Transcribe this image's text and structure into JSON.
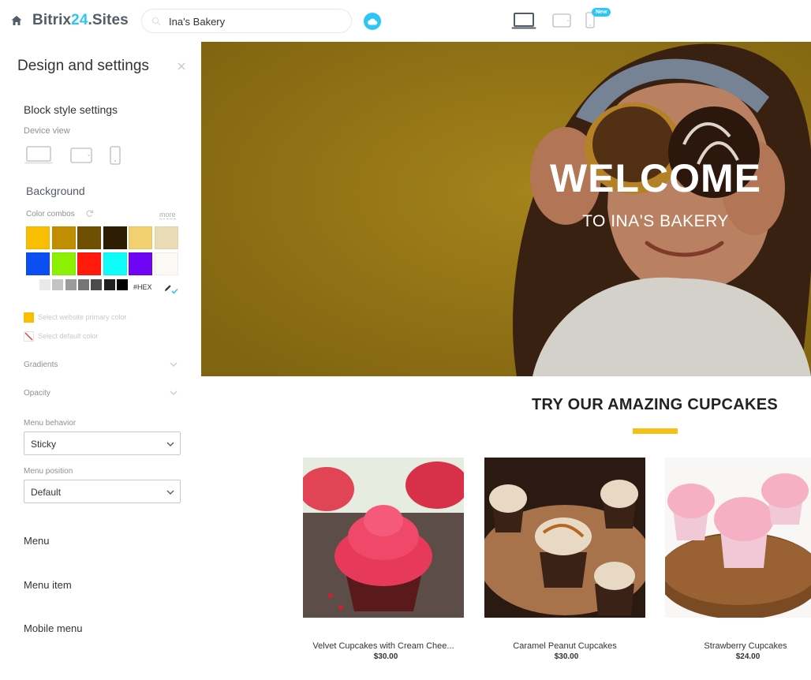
{
  "app": {
    "logo_part1": "Bitrix",
    "logo_part2": "24",
    "logo_part3": ".Sites",
    "site_name": "Ina's Bakery",
    "new_badge": "New"
  },
  "panel": {
    "title": "Design and settings",
    "section_title": "Block style settings",
    "device_view_label": "Device view",
    "background_title": "Background",
    "color_combos_label": "Color combos",
    "more_link": "more",
    "colors_row1": [
      "#f9bd02",
      "#c08d03",
      "#6f4f02",
      "#2d1d05",
      "#f2d06f",
      "#eadbb7"
    ],
    "colors_row2": [
      "#0b4ff2",
      "#8cf003",
      "#ff1a0b",
      "#0dfcfa",
      "#7005f5",
      "#fbf9f3"
    ],
    "grays": [
      "#e9e9e9",
      "#c3c3c3",
      "#9b9b9b",
      "#757575",
      "#4b4b4b",
      "#1f1f1f",
      "#000000"
    ],
    "hex_label": "#HEX",
    "primary_color_text": "Select website primary color",
    "default_color_text": "Select default color",
    "primary_color_value": "#f9bd02",
    "gradients_label": "Gradients",
    "opacity_label": "Opacity",
    "menu_behavior_label": "Menu behavior",
    "menu_behavior_value": "Sticky",
    "menu_position_label": "Menu position",
    "menu_position_value": "Default",
    "links": [
      "Menu",
      "Menu item",
      "Mobile menu"
    ]
  },
  "hero": {
    "title": "WELCOME",
    "subtitle": "TO INA'S BAKERY"
  },
  "products_section": {
    "heading": "TRY OUR AMAZING CUPCAKES",
    "accent_color": "#f5c116",
    "items": [
      {
        "name": "Velvet Cupcakes with Cream Chee...",
        "price": "$30.00"
      },
      {
        "name": "Caramel Peanut Cupcakes",
        "price": "$30.00"
      },
      {
        "name": "Strawberry Cupcakes",
        "price": "$24.00"
      }
    ]
  }
}
